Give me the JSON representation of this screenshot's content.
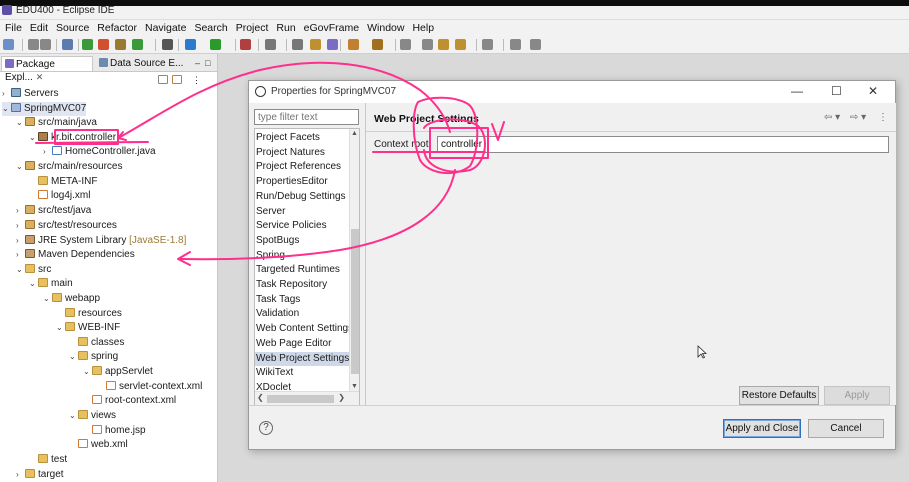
{
  "window": {
    "title": "EDU400 - Eclipse IDE"
  },
  "menu": [
    "File",
    "Edit",
    "Source",
    "Refactor",
    "Navigate",
    "Search",
    "Project",
    "Run",
    "eGovFrame",
    "Window",
    "Help"
  ],
  "views": {
    "package_explorer_tab": "Package Expl...",
    "datasource_tab": "Data Source E...",
    "close_glyph": "✕"
  },
  "tree": [
    {
      "label": "Servers",
      "decoration": "",
      "icon": "srv",
      "toggle": "›"
    },
    {
      "label": "SpringMVC07",
      "decoration": "",
      "icon": "proj",
      "toggle": "⌄"
    },
    {
      "label": "src/main/java",
      "decoration": "",
      "icon": "pkgf",
      "toggle": "⌄"
    },
    {
      "label": "kr.bit.controller",
      "decoration": "",
      "icon": "pkg",
      "toggle": "⌄"
    },
    {
      "label": "HomeController.java",
      "decoration": "",
      "icon": "java",
      "toggle": "›"
    },
    {
      "label": "src/main/resources",
      "decoration": "",
      "icon": "pkgf",
      "toggle": "⌄"
    },
    {
      "label": "META-INF",
      "decoration": "",
      "icon": "folder",
      "toggle": ""
    },
    {
      "label": "log4j.xml",
      "decoration": "",
      "icon": "xml",
      "toggle": ""
    },
    {
      "label": "src/test/java",
      "decoration": "",
      "icon": "pkgf",
      "toggle": "›"
    },
    {
      "label": "src/test/resources",
      "decoration": "",
      "icon": "pkgf",
      "toggle": "›"
    },
    {
      "label": "JRE System Library",
      "decoration": " [JavaSE-1.8]",
      "icon": "lib",
      "toggle": "›"
    },
    {
      "label": "Maven Dependencies",
      "decoration": "",
      "icon": "lib",
      "toggle": "›"
    },
    {
      "label": "src",
      "decoration": "",
      "icon": "folder",
      "toggle": "⌄"
    },
    {
      "label": "main",
      "decoration": "",
      "icon": "folder",
      "toggle": "⌄"
    },
    {
      "label": "webapp",
      "decoration": "",
      "icon": "folder",
      "toggle": "⌄"
    },
    {
      "label": "resources",
      "decoration": "",
      "icon": "folder",
      "toggle": ""
    },
    {
      "label": "WEB-INF",
      "decoration": "",
      "icon": "folder",
      "toggle": "⌄"
    },
    {
      "label": "classes",
      "decoration": "",
      "icon": "folder",
      "toggle": ""
    },
    {
      "label": "spring",
      "decoration": "",
      "icon": "folder",
      "toggle": "⌄"
    },
    {
      "label": "appServlet",
      "decoration": "",
      "icon": "folder",
      "toggle": "⌄"
    },
    {
      "label": "servlet-context.xml",
      "decoration": "",
      "icon": "xml",
      "toggle": ""
    },
    {
      "label": "root-context.xml",
      "decoration": "",
      "icon": "xml",
      "toggle": ""
    },
    {
      "label": "views",
      "decoration": "",
      "icon": "folder",
      "toggle": "⌄"
    },
    {
      "label": "home.jsp",
      "decoration": "",
      "icon": "xml",
      "toggle": ""
    },
    {
      "label": "web.xml",
      "decoration": "",
      "icon": "xml",
      "toggle": ""
    },
    {
      "label": "test",
      "decoration": "",
      "icon": "folder",
      "toggle": ""
    },
    {
      "label": "target",
      "decoration": "",
      "icon": "folder",
      "toggle": "›"
    }
  ],
  "dialog": {
    "title": "Properties for SpringMVC07",
    "minimize": "—",
    "maximize": "☐",
    "close": "✕",
    "filter_placeholder": "type filter text",
    "categories": [
      "Project Facets",
      "Project Natures",
      "Project References",
      "PropertiesEditor",
      "Run/Debug Settings",
      "Server",
      "Service Policies",
      "SpotBugs",
      "Spring",
      "Targeted Runtimes",
      "Task Repository",
      "Task Tags",
      "Validation",
      "Web Content Settings",
      "Web Page Editor",
      "Web Project Settings",
      "WikiText",
      "XDoclet"
    ],
    "selected_category": "Web Project Settings",
    "page_title": "Web Project Settings",
    "nav_back": "⇦ ▾",
    "nav_forward": "⇨ ▾",
    "nav_menu": "⋮",
    "context_root_label": "Context root:",
    "context_root_value": "controller",
    "restore_defaults": "Restore Defaults",
    "apply": "Apply",
    "apply_and_close": "Apply and Close",
    "cancel": "Cancel",
    "help": "?",
    "scroll_up": "▲",
    "scroll_down": "▼",
    "scroll_left": "❮",
    "scroll_right": "❯"
  },
  "colors": {
    "annotation": "#ff2f8c",
    "selection": "#cfd8e8"
  }
}
